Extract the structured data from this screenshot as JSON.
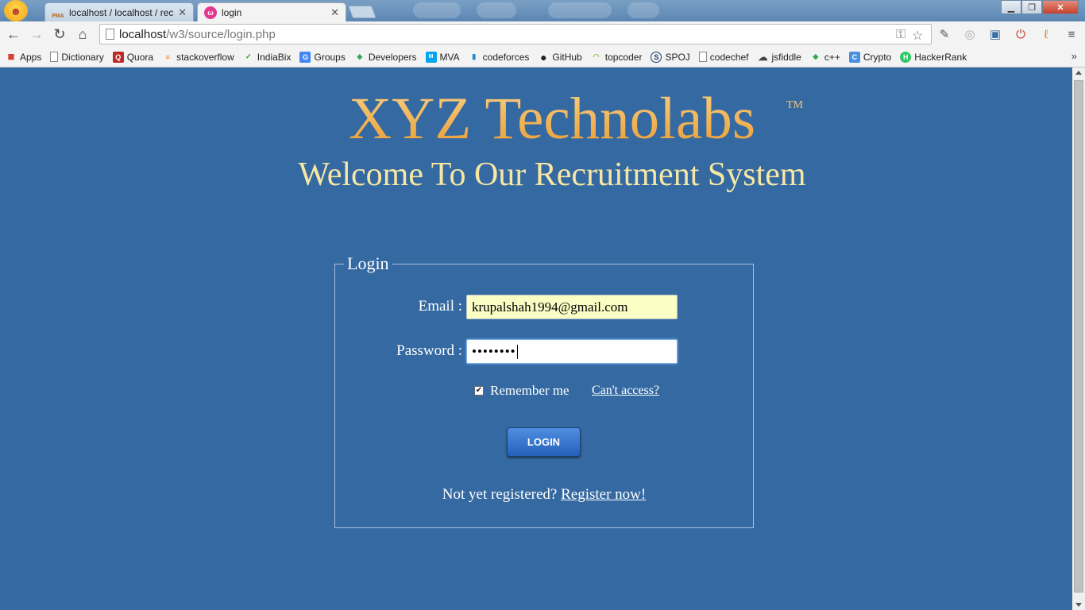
{
  "browser": {
    "tabs": [
      {
        "title": "localhost / localhost / rec",
        "icon": "phpmyadmin-icon",
        "icon_text": "PMA"
      },
      {
        "title": "login",
        "icon": "login-favicon"
      }
    ],
    "url_host": "localhost",
    "url_path": "/w3/source/login.php"
  },
  "bookmarks": [
    {
      "label": "Apps",
      "icon": "apps-grid-icon",
      "icon_glyph": "▦",
      "color": "#d93025"
    },
    {
      "label": "Dictionary",
      "icon": "page-icon",
      "icon_glyph": "",
      "color": "#ffffff"
    },
    {
      "label": "Quora",
      "icon": "quora-icon",
      "icon_glyph": "Q",
      "color": "#b92b27"
    },
    {
      "label": "stackoverflow",
      "icon": "stackoverflow-icon",
      "icon_glyph": "≡",
      "color": "#f48024"
    },
    {
      "label": "IndiaBix",
      "icon": "indiabix-icon",
      "icon_glyph": "✓",
      "color": "#3c8d2f"
    },
    {
      "label": "Groups",
      "icon": "groups-icon",
      "icon_glyph": "G",
      "color": "#4285f4"
    },
    {
      "label": "Developers",
      "icon": "developers-icon",
      "icon_glyph": "◆",
      "color": "#34a853"
    },
    {
      "label": "MVA",
      "icon": "mva-icon",
      "icon_glyph": "M",
      "color": "#00a4ef"
    },
    {
      "label": "codeforces",
      "icon": "codeforces-icon",
      "icon_glyph": "▮",
      "color": "#1f8acb"
    },
    {
      "label": "GitHub",
      "icon": "github-icon",
      "icon_glyph": "●",
      "color": "#222222"
    },
    {
      "label": "topcoder",
      "icon": "topcoder-icon",
      "icon_glyph": "◠",
      "color": "#8cc63e"
    },
    {
      "label": "SPOJ",
      "icon": "spoj-icon",
      "icon_glyph": "S",
      "color": "#1b3a6b"
    },
    {
      "label": "codechef",
      "icon": "page-icon",
      "icon_glyph": "",
      "color": "#ffffff"
    },
    {
      "label": "jsfiddle",
      "icon": "jsfiddle-icon",
      "icon_glyph": "☁",
      "color": "#444444"
    },
    {
      "label": "c++",
      "icon": "cpp-icon",
      "icon_glyph": "◆",
      "color": "#34a853"
    },
    {
      "label": "Crypto",
      "icon": "crypto-icon",
      "icon_glyph": "C",
      "color": "#4a90e2"
    },
    {
      "label": "HackerRank",
      "icon": "hackerrank-icon",
      "icon_glyph": "H",
      "color": "#2ec866"
    }
  ],
  "page": {
    "brand": "XYZ Technolabs",
    "trademark": "TM",
    "welcome": "Welcome To Our Recruitment System",
    "login": {
      "legend": "Login",
      "email_label": "Email :",
      "email_value": "krupalshah1994@gmail.com",
      "password_label": "Password :",
      "password_value": "••••••••",
      "remember_label": "Remember me",
      "remember_checked": true,
      "cant_access": "Can't access?",
      "button_label": "LOGIN",
      "register_prompt": "Not yet registered?",
      "register_link": "Register now!"
    }
  },
  "colors": {
    "page_bg": "#3569a1",
    "brand": "#f5b045",
    "welcome": "#f7e7a4",
    "button": "#3b78d0"
  }
}
